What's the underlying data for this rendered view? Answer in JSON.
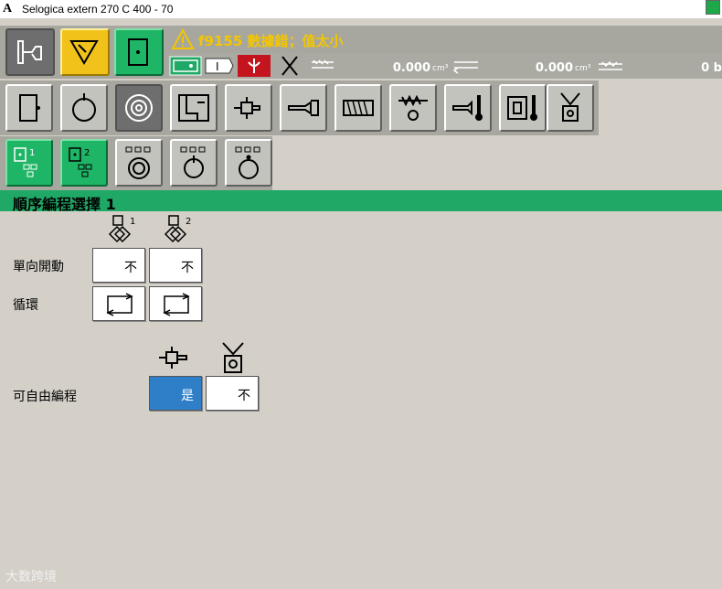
{
  "window": {
    "logo": "A",
    "title": "Selogica extern  270 C  400 -  70"
  },
  "status": {
    "message": "f9155 數據錯；值太小"
  },
  "readings": [
    {
      "value": "0.000",
      "unit": "cm³"
    },
    {
      "value": "0.000",
      "unit": "cm³"
    },
    {
      "value": "0 b",
      "unit": ""
    }
  ],
  "section": {
    "title": "順序編程選擇 1"
  },
  "rows": {
    "single_start": {
      "label": "單向開動",
      "col1": "不",
      "col2": "不"
    },
    "cycle": {
      "label": "循環"
    },
    "free_prog": {
      "label": "可自由編程",
      "col1": "是",
      "col2": "不"
    }
  },
  "column_headers": {
    "seq1": "1",
    "seq2": "2"
  },
  "watermark": "大数跨境",
  "colors": {
    "accent_green": "#1fa866",
    "warning_yellow": "#f3c600",
    "selected_blue": "#2f7ec8"
  }
}
